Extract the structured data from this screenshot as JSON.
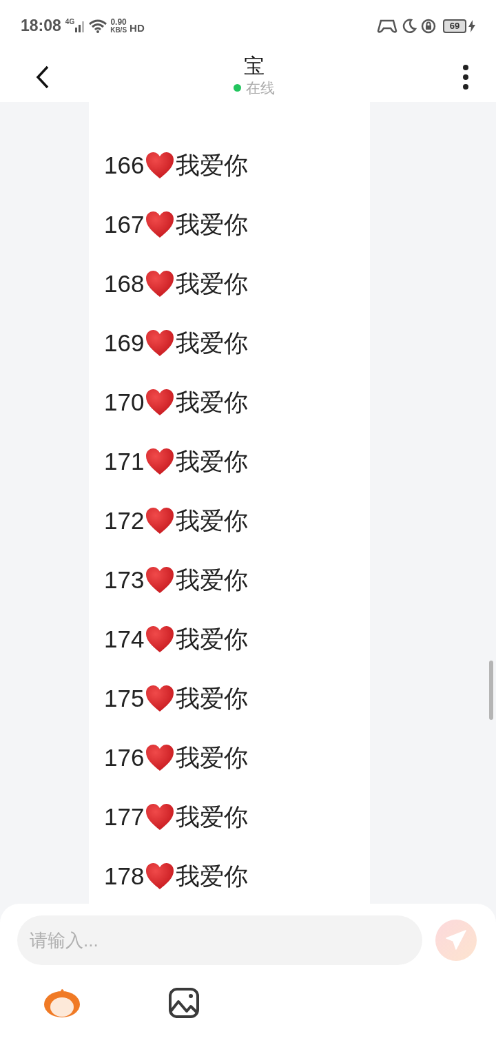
{
  "status_bar": {
    "time": "18:08",
    "network": "4G",
    "speed_value": "0.90",
    "speed_unit": "KB/S",
    "hd": "HD",
    "battery": "69"
  },
  "header": {
    "title": "宝",
    "status": "在线",
    "online": true
  },
  "messages": [
    {
      "number": "166",
      "text": "我爱你"
    },
    {
      "number": "167",
      "text": "我爱你"
    },
    {
      "number": "168",
      "text": "我爱你"
    },
    {
      "number": "169",
      "text": "我爱你"
    },
    {
      "number": "170",
      "text": "我爱你"
    },
    {
      "number": "171",
      "text": "我爱你"
    },
    {
      "number": "172",
      "text": "我爱你"
    },
    {
      "number": "173",
      "text": "我爱你"
    },
    {
      "number": "174",
      "text": "我爱你"
    },
    {
      "number": "175",
      "text": "我爱你"
    },
    {
      "number": "176",
      "text": "我爱你"
    },
    {
      "number": "177",
      "text": "我爱你"
    },
    {
      "number": "178",
      "text": "我爱你"
    }
  ],
  "composer": {
    "placeholder": "请输入...",
    "send_disabled": true
  }
}
